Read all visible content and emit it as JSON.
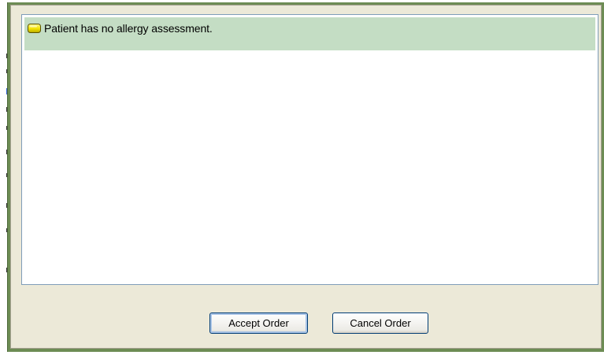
{
  "dialog": {
    "message": {
      "icon": "yellow-alert-icon",
      "text": "Patient has no allergy assessment."
    },
    "buttons": {
      "accept_label": "Accept Order",
      "cancel_label": "Cancel Order"
    }
  },
  "colors": {
    "message_highlight": "#c4ddc4",
    "icon_fill": "#f2e200",
    "frame": "#6d8c54",
    "dialog_bg": "#ece9d8"
  }
}
